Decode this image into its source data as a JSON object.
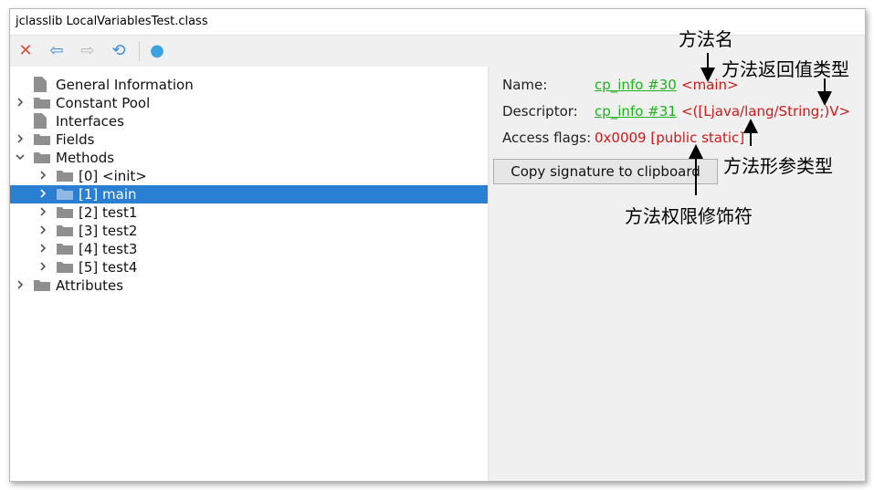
{
  "window": {
    "title": "jclasslib LocalVariablesTest.class"
  },
  "toolbar": {
    "buttons": [
      {
        "name": "close-button",
        "icon": "close-icon",
        "glyph": "✕",
        "color": "#e04a3a"
      },
      {
        "name": "back-button",
        "icon": "arrow-left-icon",
        "glyph": "⇦",
        "color": "#3a8fd8"
      },
      {
        "name": "forward-button",
        "icon": "arrow-right-icon",
        "glyph": "⇨",
        "color": "#b9b9b9"
      },
      {
        "name": "reload-button",
        "icon": "reload-icon",
        "glyph": "⟲",
        "color": "#3a8fd8"
      },
      {
        "name": "web-button",
        "icon": "globe-icon",
        "glyph": "●",
        "color": "#3aa3e0"
      }
    ]
  },
  "tree": {
    "items": [
      {
        "label": "General Information",
        "level": 0,
        "expander": "none",
        "icon": "document-icon"
      },
      {
        "label": "Constant Pool",
        "level": 0,
        "expander": "collapsed",
        "icon": "folder-icon"
      },
      {
        "label": "Interfaces",
        "level": 0,
        "expander": "none",
        "icon": "document-icon"
      },
      {
        "label": "Fields",
        "level": 0,
        "expander": "collapsed",
        "icon": "folder-icon"
      },
      {
        "label": "Methods",
        "level": 0,
        "expander": "expanded",
        "icon": "folder-icon"
      },
      {
        "label": "[0] <init>",
        "level": 1,
        "expander": "collapsed",
        "icon": "folder-icon"
      },
      {
        "label": "[1] main",
        "level": 1,
        "expander": "collapsed",
        "icon": "folder-icon",
        "selected": true
      },
      {
        "label": "[2] test1",
        "level": 1,
        "expander": "collapsed",
        "icon": "folder-icon"
      },
      {
        "label": "[3] test2",
        "level": 1,
        "expander": "collapsed",
        "icon": "folder-icon"
      },
      {
        "label": "[4] test3",
        "level": 1,
        "expander": "collapsed",
        "icon": "folder-icon"
      },
      {
        "label": "[5] test4",
        "level": 1,
        "expander": "collapsed",
        "icon": "folder-icon"
      },
      {
        "label": "Attributes",
        "level": 0,
        "expander": "collapsed",
        "icon": "folder-icon"
      }
    ]
  },
  "detail": {
    "name_label": "Name:",
    "name_link": "cp_info #30",
    "name_value": "<main>",
    "descriptor_label": "Descriptor:",
    "descriptor_link": "cp_info #31",
    "descriptor_value": "<([Ljava/lang/String;)V>",
    "access_label": "Access flags:",
    "access_value": "0x0009 [public static]",
    "copy_button": "Copy signature to clipboard"
  },
  "annotations": {
    "method_name": "方法名",
    "return_type": "方法返回值类型",
    "param_types": "方法形参类型",
    "access_modifiers": "方法权限修饰符"
  },
  "colors": {
    "selection": "#2a7fd3",
    "link": "#1db31d",
    "value_red": "#cc1a1a",
    "folder": "#8f8f8f"
  }
}
